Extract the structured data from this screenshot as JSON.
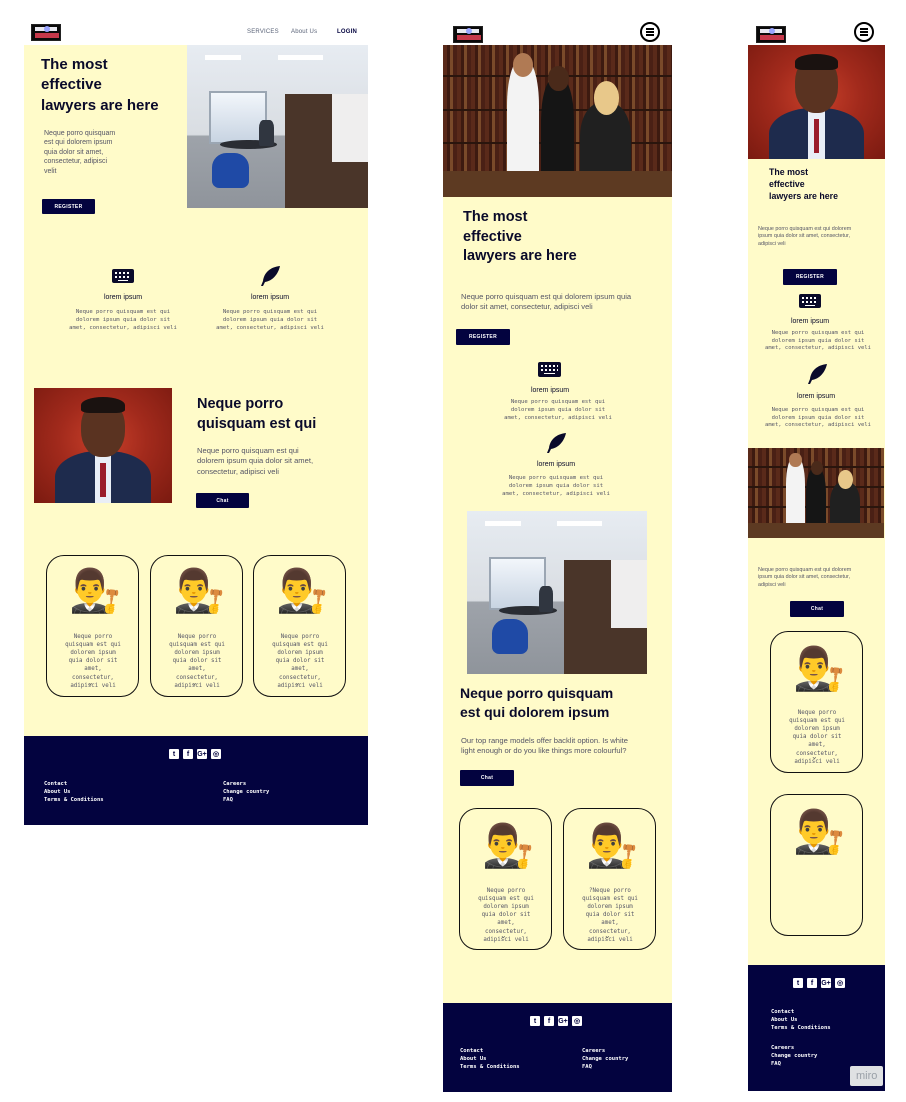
{
  "logo": {
    "alt": "law firm logo"
  },
  "desktop": {
    "nav": {
      "services": "SERVICES",
      "about": "About Us",
      "login": "LOGIN"
    },
    "hero": {
      "title_lines": [
        "The most",
        "effective",
        "lawyers are here"
      ],
      "text_lines": [
        "Neque porro quisquam",
        "est qui dolorem ipsum",
        "quia dolor sit amet,",
        "consectetur, adipisci",
        "velit"
      ],
      "register": "REGISTER"
    },
    "features": [
      {
        "icon": "keyboard-icon",
        "title": "lorem ipsum",
        "lines": [
          "Neque porro quisquam est qui",
          "dolorem ipsum quia dolor sit",
          "amet, consectetur, adipisci veli"
        ]
      },
      {
        "icon": "quill-icon",
        "title": "lorem ipsum",
        "lines": [
          "Neque porro quisquam est qui",
          "dolorem ipsum quia dolor sit",
          "amet, consectetur, adipisci veli"
        ]
      }
    ],
    "about": {
      "title_lines": [
        "Neque porro",
        "quisquam est qui"
      ],
      "text_lines": [
        "Neque porro quisquam est qui",
        "dolorem ipsum quia dolor sit amet,",
        "consectetur, adipisci veli"
      ],
      "chat": "Chat"
    },
    "cards": [
      {
        "lines": [
          "Neque porro",
          "quisquam est qui",
          "dolorem ipsum",
          "quia dolor sit",
          "amet,",
          "consectetur,",
          "adipisci veli"
        ]
      },
      {
        "lines": [
          "Neque porro",
          "quisquam est qui",
          "dolorem ipsum",
          "quia dolor sit",
          "amet,",
          "consectetur,",
          "adipisci veli"
        ]
      },
      {
        "lines": [
          "Neque porro",
          "quisquam est qui",
          "dolorem ipsum",
          "quia dolor sit",
          "amet,",
          "consectetur,",
          "adipisci veli"
        ]
      }
    ],
    "footer": {
      "social": [
        "t",
        "f",
        "G+",
        "◎"
      ],
      "left": [
        "Contact",
        "About Us",
        "Terms & Conditions"
      ],
      "right": [
        "Careers",
        "Change country",
        "FAQ"
      ]
    }
  },
  "tablet": {
    "hero": {
      "title_lines": [
        "The most",
        "effective",
        "lawyers are here"
      ],
      "text_lines": [
        "Neque porro quisquam est qui dolorem ipsum quia",
        "dolor sit amet, consectetur, adipisci veli"
      ],
      "register": "REGISTER"
    },
    "features": [
      {
        "icon": "keyboard-icon",
        "title": "lorem ipsum",
        "lines": [
          "Neque porro quisquam est qui",
          "dolorem ipsum quia dolor sit",
          "amet, consectetur, adipisci veli"
        ]
      },
      {
        "icon": "quill-icon",
        "title": "lorem ipsum",
        "lines": [
          "Neque porro quisquam est qui",
          "dolorem ipsum quia dolor sit",
          "amet, consectetur, adipisci veli"
        ]
      }
    ],
    "about": {
      "title_lines": [
        "Neque porro quisquam",
        "est qui dolorem ipsum"
      ],
      "text_lines": [
        "Our top range models offer backlit option. Is white",
        "light enough or do you like things more colourful?"
      ],
      "chat": "Chat"
    },
    "cards": [
      {
        "lines": [
          "Neque porro",
          "quisquam est qui",
          "dolorem ipsum",
          "quia dolor sit",
          "amet,",
          "consectetur,",
          "adipisci veli"
        ]
      },
      {
        "lines": [
          "?Neque porro",
          "quisquam est qui",
          "dolorem ipsum",
          "quia dolor sit",
          "amet,",
          "consectetur,",
          "adipisci veli"
        ]
      }
    ],
    "footer": {
      "social": [
        "t",
        "f",
        "G+",
        "◎"
      ],
      "left": [
        "Contact",
        "About Us",
        "Terms & Conditions"
      ],
      "right": [
        "Careers",
        "Change country",
        "FAQ"
      ]
    }
  },
  "mobile": {
    "hero": {
      "title_lines": [
        "The most",
        "effective",
        "lawyers are here"
      ],
      "text_lines": [
        "Neque porro quisquam est qui dolorem",
        "ipsum quia dolor sit amet, consectetur,",
        "adipisci veli"
      ],
      "register": "REGISTER"
    },
    "features": [
      {
        "icon": "keyboard-icon",
        "title": "lorem ipsum",
        "lines": [
          "Neque porro quisquam est qui",
          "dolorem ipsum quia dolor sit",
          "amet, consectetur, adipisci veli"
        ]
      },
      {
        "icon": "quill-icon",
        "title": "lorem ipsum",
        "lines": [
          "Neque porro quisquam est qui",
          "dolorem ipsum quia dolor sit",
          "amet, consectetur, adipisci veli"
        ]
      }
    ],
    "about": {
      "text_lines": [
        "Neque porro quisquam est qui dolorem",
        "ipsum quia dolor sit amet, consectetur,",
        "adipisci veli"
      ],
      "chat": "Chat"
    },
    "cards": [
      {
        "lines": [
          "Neque porro",
          "quisquam est qui",
          "dolorem ipsum",
          "quia dolor sit",
          "amet,",
          "consectetur,",
          "adipisci veli"
        ]
      },
      {
        "lines": []
      }
    ],
    "footer": {
      "social": [
        "t",
        "f",
        "G+",
        "◎"
      ],
      "left": [
        "Contact",
        "About Us",
        "Terms & Conditions"
      ],
      "right": [
        "Careers",
        "Change country",
        "FAQ"
      ]
    }
  },
  "watermark": "miro",
  "colors": {
    "background": "#fffbc9",
    "navy": "#03033f",
    "text": "#0a0a2a"
  }
}
